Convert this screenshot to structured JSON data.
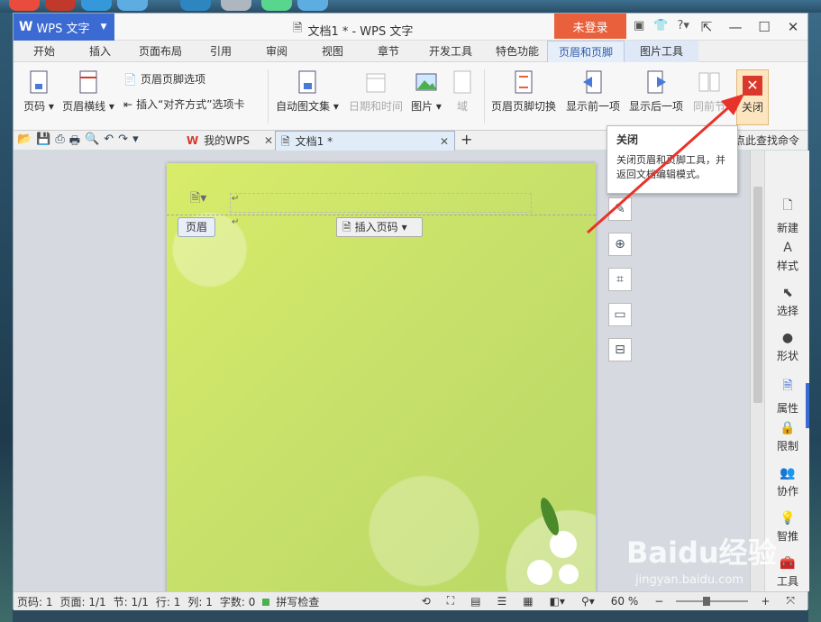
{
  "titlebar": {
    "app_name": "WPS 文字",
    "doc_title": "文档1 * - WPS 文字",
    "login": "未登录"
  },
  "ribbon_tabs": [
    "开始",
    "插入",
    "页面布局",
    "引用",
    "审阅",
    "视图",
    "章节",
    "开发工具",
    "特色功能",
    "页眉和页脚",
    "图片工具"
  ],
  "ribbon": {
    "page_number": "页码",
    "header_line": "页眉横线",
    "header_footer_options": "页眉页脚选项",
    "insert_align_tab": "插入“对齐方式”选项卡",
    "auto_text": "自动图文集",
    "date_time": "日期和时间",
    "picture": "图片",
    "field": "域",
    "switch_header_footer": "页眉页脚切换",
    "show_previous": "显示前一项",
    "show_next": "显示后一项",
    "same_as_previous": "同前节",
    "close": "关闭"
  },
  "doc_tabs": [
    {
      "label": "我的WPS"
    },
    {
      "label": "文档1 *"
    }
  ],
  "find_command": "点此查找命令",
  "tooltip": {
    "title": "关闭",
    "body": "关闭页眉和页脚工具，并返回文档编辑模式。"
  },
  "page": {
    "header_label": "页眉",
    "insert_page_number": "插入页码"
  },
  "right_panel": [
    "新建",
    "样式",
    "选择",
    "形状",
    "属性",
    "限制",
    "协作",
    "智推",
    "工具"
  ],
  "status": {
    "page_code": "页码: 1",
    "pages": "页面: 1/1",
    "section": "节: 1/1",
    "row": "行: 1",
    "col": "列: 1",
    "chars": "字数: 0",
    "spell": "拼写检查",
    "zoom": "60 %"
  },
  "watermark": {
    "brand": "Baidu经验",
    "url": "jingyan.baidu.com"
  },
  "colors": {
    "accent_blue": "#3c6ad3",
    "login_orange": "#e8603c",
    "close_red": "#d9392c",
    "annotation_arrow": "#e8332a"
  }
}
